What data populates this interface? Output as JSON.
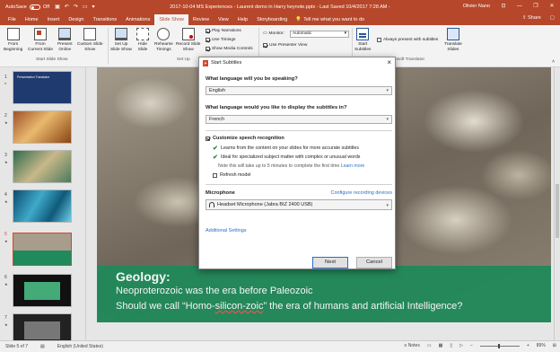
{
  "titlebar": {
    "autosave": "AutoSave",
    "autosave_state": "Off",
    "doc_title": "2017-10-04 MS Experiences - Laurent demo in Harry keynote.pptx  -  Last Saved 10/4/2017 7:28 AM  -",
    "user": "Olivier Nano"
  },
  "tabs": [
    "File",
    "Home",
    "Insert",
    "Design",
    "Transitions",
    "Animations",
    "Slide Show",
    "Review",
    "View",
    "Help",
    "Storyboarding"
  ],
  "active_tab": "Slide Show",
  "tell_me": "Tell me what you want to do",
  "share": "Share",
  "ribbon": {
    "from_beginning": "From\nBeginning",
    "from_current": "From\nCurrent Slide",
    "present_online": "Present\nOnline",
    "custom_show": "Custom Slide\nShow",
    "group_start": "Start Slide Show",
    "set_up": "Set Up\nSlide Show",
    "hide_slide": "Hide\nSlide",
    "rehearse": "Rehearse\nTimings",
    "record": "Record Slide\nShow",
    "group_setup": "Set Up",
    "play_narrations": "Play Narrations",
    "use_timings": "Use Timings",
    "show_media": "Show Media Controls",
    "monitor_label": "Monitor:",
    "monitor_value": "Automatic",
    "presenter_view": "Use Presenter View",
    "start_subtitles": "Start\nSubtitles",
    "always_present": "Always present with subtitles",
    "translate_slides": "Translate\nSlides",
    "group_translator": "osoft Translator"
  },
  "slides": [
    {
      "num": "1"
    },
    {
      "num": "2"
    },
    {
      "num": "3"
    },
    {
      "num": "4"
    },
    {
      "num": "5"
    },
    {
      "num": "6"
    },
    {
      "num": "7"
    }
  ],
  "thumb1_title": "Presentation Translator",
  "slide": {
    "heading": "Geology:",
    "line1": "Neoproterozoic was the era before Paleozoic",
    "line2_a": "Should we call “Homo-",
    "line2_b": "silicon-zoic",
    "line2_c": "” the era of humans and artificial Intelligence?"
  },
  "dialog": {
    "title": "Start Subtitles",
    "q1": "What language will you be speaking?",
    "speak_lang": "English",
    "q2": "What language would you like to display the subtitles in?",
    "sub_lang": "French",
    "customize": "Customize speech recognition",
    "b1": "Learns from the content on your slides for more accurate subtitles",
    "b2": "Ideal for specialized subject matter with complex or unusual words",
    "note": "Note this will take up to 5 minutes to complete the first time",
    "learn_more": "Learn more",
    "refresh": "Refresh model",
    "microphone": "Microphone",
    "configure": "Configure recording devices",
    "mic_value": "Headset Microphone (Jabra BIZ 2400 USB)",
    "additional": "Additional Settings",
    "next": "Next",
    "cancel": "Cancel"
  },
  "status": {
    "slide_of": "Slide 5 of 7",
    "language": "English (United States)",
    "notes": "Notes",
    "zoom": "89%"
  },
  "colors": {
    "accent": "#b7472a",
    "caption": "#1e8a5a",
    "link": "#2b6ec8"
  }
}
